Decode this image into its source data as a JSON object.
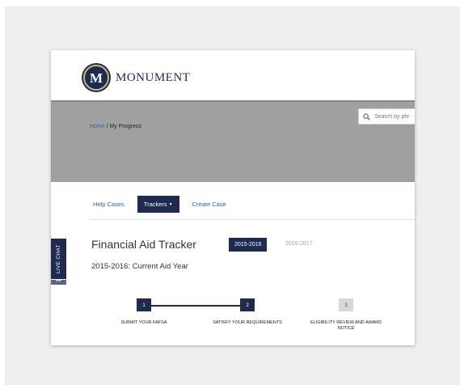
{
  "brand": {
    "name": "MONUMENT",
    "seal_letter": "M"
  },
  "breadcrumb": {
    "home": "Home",
    "separator": "/",
    "current": "My Progress"
  },
  "search": {
    "placeholder": "Search by phr"
  },
  "tabs": [
    {
      "label": "Help Cases",
      "active": false
    },
    {
      "label": "Trackers",
      "active": true
    },
    {
      "label": "Create Case",
      "active": false
    }
  ],
  "live_chat": {
    "label": "LIVE CHAT",
    "dots": "•••"
  },
  "tracker": {
    "title": "Financial Aid Tracker",
    "years": [
      "2015-2016",
      "2016-2017"
    ],
    "selected_year": "2015-2016",
    "subtitle": "2015-2016: Current Aid Year",
    "steps": [
      {
        "number": "1",
        "label": "SUBMIT YOUR FAFSA",
        "status": "done"
      },
      {
        "number": "2",
        "label": "SATISFY YOUR REQUIREMENTS",
        "status": "done"
      },
      {
        "number": "3",
        "label": "ELIGIBILITY REVIEW AND AWARD NOTICE",
        "status": "todo"
      }
    ]
  },
  "colors": {
    "navy": "#1e2a4f",
    "link": "#3565a8",
    "hero_gray": "#a0a0a0",
    "gold": "#c9b27c"
  }
}
